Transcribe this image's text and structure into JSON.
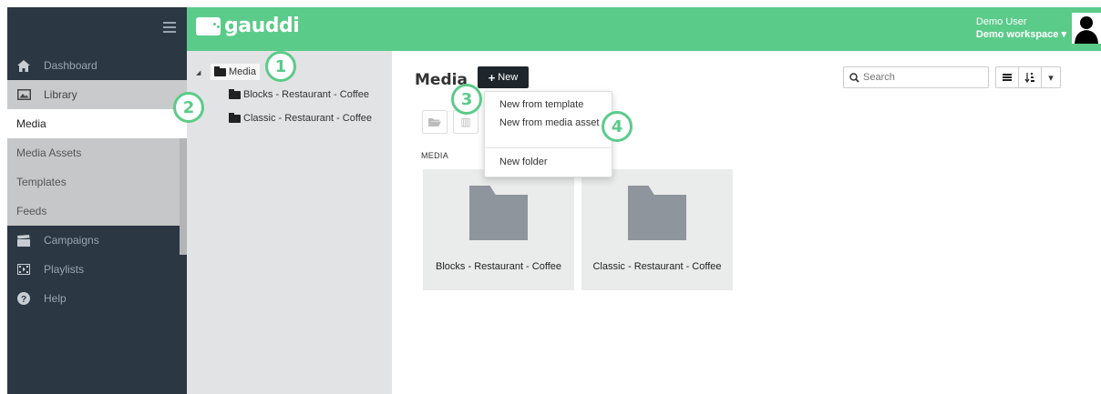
{
  "app": {
    "logo_text": "gauddi",
    "brand_color": "#5bcb8a",
    "sidebar_color": "#2b3743"
  },
  "user": {
    "name": "Demo User",
    "workspace": "Demo workspace"
  },
  "sidebar": {
    "items": [
      {
        "label": "Dashboard",
        "icon": "home-icon"
      },
      {
        "label": "Library",
        "icon": "image-icon"
      },
      {
        "label": "Campaigns",
        "icon": "clapperboard-icon"
      },
      {
        "label": "Playlists",
        "icon": "film-strip-icon"
      },
      {
        "label": "Help",
        "icon": "help-icon"
      }
    ],
    "library_sub": [
      "Media",
      "Media Assets",
      "Templates",
      "Feeds"
    ],
    "active_sub": "Media"
  },
  "tree": {
    "root": "Media",
    "children": [
      "Blocks - Restaurant - Coffee",
      "Classic - Restaurant - Coffee"
    ]
  },
  "main": {
    "title": "Media",
    "new_button": "New",
    "search_placeholder": "Search",
    "section_label": "MEDIA",
    "cards": [
      "Blocks - Restaurant - Coffee",
      "Classic - Restaurant - Coffee"
    ]
  },
  "dropdown": {
    "items": [
      "New from template",
      "New from media asset",
      "New folder"
    ]
  },
  "callouts": [
    "1",
    "2",
    "3",
    "4"
  ]
}
